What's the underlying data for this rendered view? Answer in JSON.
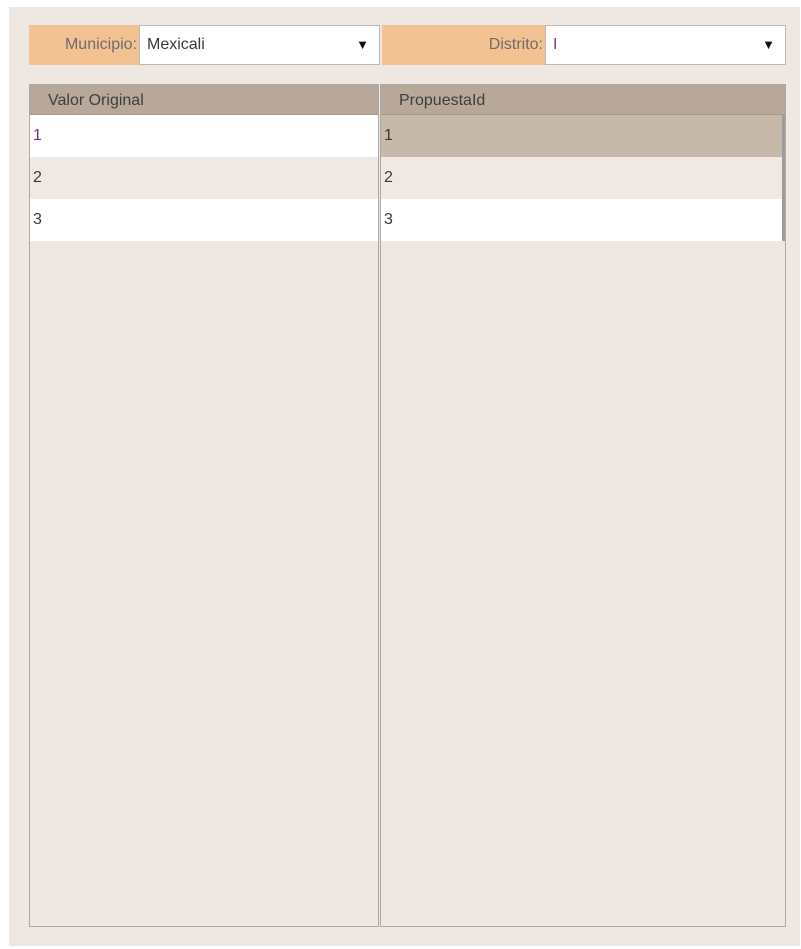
{
  "filters": {
    "municipio": {
      "label": "Municipio:",
      "value": "Mexicali",
      "arrow": "▼"
    },
    "distrito": {
      "label": "Distrito:",
      "value": "I",
      "arrow": "▼"
    }
  },
  "lists": {
    "original": {
      "header": "Valor Original",
      "rows": [
        "1",
        "2",
        "3"
      ]
    },
    "propuesta": {
      "header": "PropuestaId",
      "rows": [
        "1",
        "2",
        "3"
      ],
      "selected_index": 0
    }
  },
  "colors": {
    "panel_bg": "#efe7e2",
    "filter_label_bg": "#f3c292",
    "header_bg": "#b8a899",
    "selected_row_bg": "#c7b9aa"
  }
}
